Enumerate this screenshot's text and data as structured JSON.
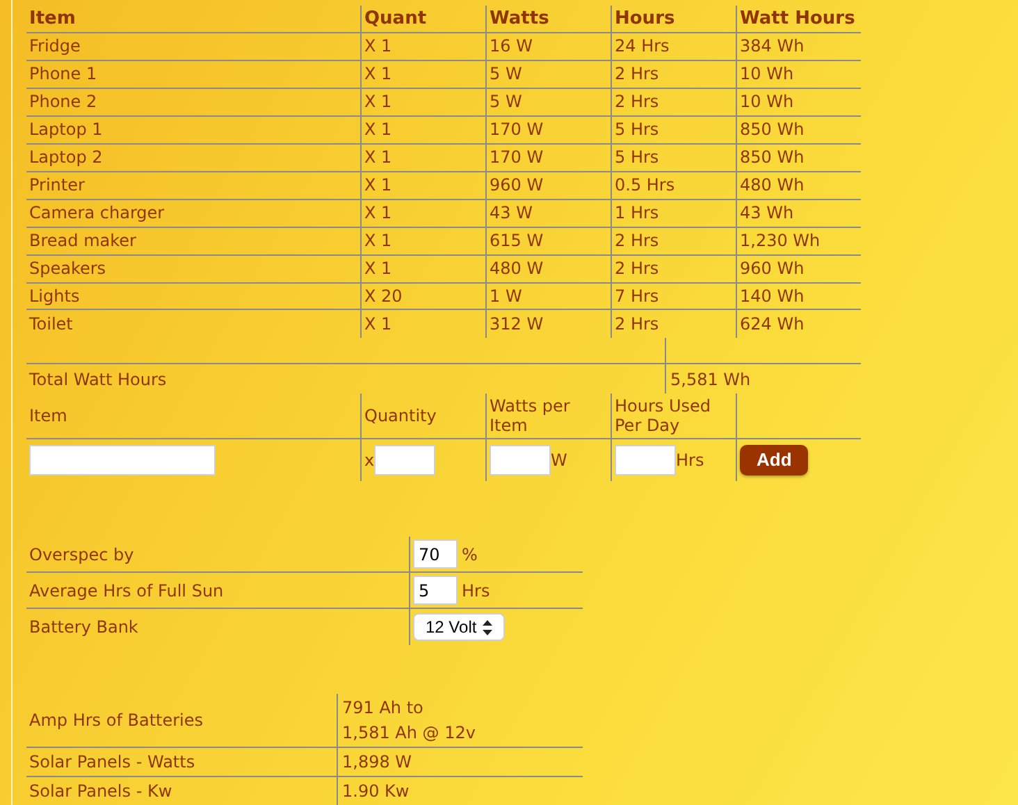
{
  "appliances": {
    "columns": [
      "Item",
      "Quant",
      "Watts",
      "Hours",
      "Watt Hours"
    ],
    "rows": [
      {
        "item": "Fridge",
        "quant": "X 1",
        "watts": "16 W",
        "hours": "24 Hrs",
        "watt_hours": "384 Wh"
      },
      {
        "item": "Phone 1",
        "quant": "X 1",
        "watts": "5 W",
        "hours": "2 Hrs",
        "watt_hours": "10 Wh"
      },
      {
        "item": "Phone 2",
        "quant": "X 1",
        "watts": "5 W",
        "hours": "2 Hrs",
        "watt_hours": "10 Wh"
      },
      {
        "item": "Laptop 1",
        "quant": "X 1",
        "watts": "170 W",
        "hours": "5 Hrs",
        "watt_hours": "850 Wh"
      },
      {
        "item": "Laptop 2",
        "quant": "X 1",
        "watts": "170 W",
        "hours": "5 Hrs",
        "watt_hours": "850 Wh"
      },
      {
        "item": "Printer",
        "quant": "X 1",
        "watts": "960 W",
        "hours": "0.5 Hrs",
        "watt_hours": "480 Wh"
      },
      {
        "item": "Camera charger",
        "quant": "X 1",
        "watts": "43 W",
        "hours": "1 Hrs",
        "watt_hours": "43 Wh"
      },
      {
        "item": "Bread maker",
        "quant": "X 1",
        "watts": "615 W",
        "hours": "2 Hrs",
        "watt_hours": "1,230 Wh"
      },
      {
        "item": "Speakers",
        "quant": "X 1",
        "watts": "480 W",
        "hours": "2 Hrs",
        "watt_hours": "960 Wh"
      },
      {
        "item": "Lights",
        "quant": "X 20",
        "watts": "1 W",
        "hours": "7 Hrs",
        "watt_hours": "140 Wh"
      },
      {
        "item": "Toilet",
        "quant": "X 1",
        "watts": "312 W",
        "hours": "2 Hrs",
        "watt_hours": "624 Wh"
      }
    ]
  },
  "total": {
    "label": "Total Watt Hours",
    "value": "5,581 Wh"
  },
  "add_form": {
    "columns": [
      "Item",
      "Quantity",
      "Watts per Item",
      "Hours Used Per Day"
    ],
    "quantity_prefix": "x",
    "watts_unit": "W",
    "hours_unit": "Hrs",
    "button": "Add"
  },
  "settings": [
    {
      "kind": "input",
      "label": "Overspec by",
      "value": "70",
      "unit": "%"
    },
    {
      "kind": "input",
      "label": "Average Hrs of Full Sun",
      "value": "5",
      "unit": "Hrs"
    },
    {
      "kind": "select",
      "label": "Battery Bank",
      "value": "12 Volt"
    }
  ],
  "results": [
    {
      "label": "Amp Hrs of Batteries",
      "lines": [
        "791 Ah to",
        "1,581 Ah @ 12v"
      ]
    },
    {
      "label": "Solar Panels - Watts",
      "lines": [
        "1,898 W"
      ]
    },
    {
      "label": "Solar Panels - Kw",
      "lines": [
        "1.90 Kw"
      ]
    }
  ]
}
